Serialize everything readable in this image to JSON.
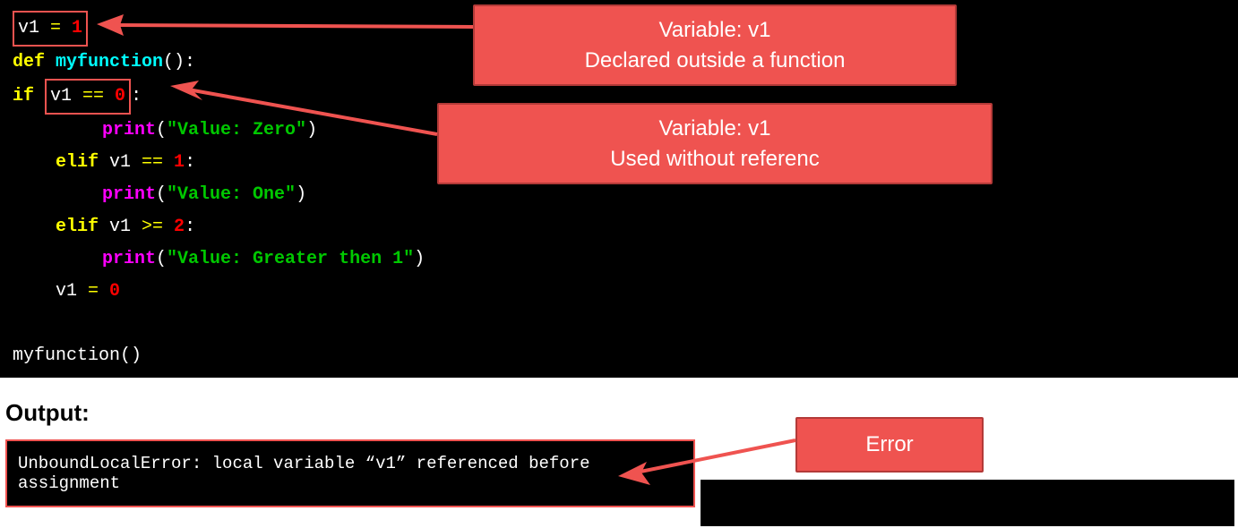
{
  "code": {
    "line1_pre": "v1 ",
    "line1_eq": "=",
    "line1_val": " 1",
    "line2_def": "def ",
    "line2_name": "myfunction",
    "line2_parens": "():",
    "line3_if": "if ",
    "line3_cond_var": "v1 ",
    "line3_cond_op": "== ",
    "line3_cond_val": "0",
    "line3_colon": ":",
    "line4_print": "print",
    "line4_paren_open": "(",
    "line4_str": "\"Value: Zero\"",
    "line4_paren_close": ")",
    "line5_elif": "elif ",
    "line5_var": "v1 ",
    "line5_op": "== ",
    "line5_val": "1",
    "line5_colon": ":",
    "line6_print": "print",
    "line6_paren_open": "(",
    "line6_str": "\"Value: One\"",
    "line6_paren_close": ")",
    "line7_elif": "elif ",
    "line7_var": "v1 ",
    "line7_op": ">= ",
    "line7_val": "2",
    "line7_colon": ":",
    "line8_print": "print",
    "line8_paren_open": "(",
    "line8_str": "\"Value: Greater then 1\"",
    "line8_paren_close": ")",
    "line9_var": "v1 ",
    "line9_eq": "= ",
    "line9_val": "0",
    "line11_call": "myfunction",
    "line11_parens": "()"
  },
  "callouts": {
    "c1_l1": "Variable: v1",
    "c1_l2": "Declared outside a function",
    "c2_l1": "Variable: v1",
    "c2_l2": "Used without referenc",
    "c3": "Error"
  },
  "output": {
    "label": "Output:",
    "text": "UnboundLocalError: local variable “v1” referenced before assignment"
  }
}
